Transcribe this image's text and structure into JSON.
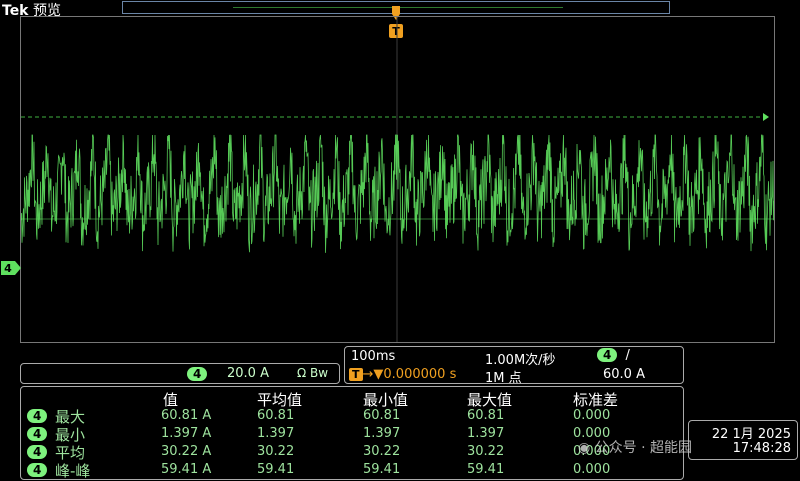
{
  "brand": {
    "logo": "Tek",
    "mode": "预览"
  },
  "colors": {
    "trace": "#5fe05f",
    "trigger": "#f0a020",
    "grid": "#6a85a6"
  },
  "trigger_marker": {
    "label": "T"
  },
  "channel": {
    "number": "4",
    "scale": "20.0 A",
    "bandwidth_icon": "Ω Bw"
  },
  "timebase": {
    "scale": "100ms",
    "rate": "1.00M次/秒",
    "trigger_pos": "0.000000 s",
    "record": "1M 点",
    "trigger_channel": "4",
    "trigger_slope": "/",
    "trigger_level": "60.0 A"
  },
  "measurements": {
    "headers": [
      "值",
      "平均值",
      "最小值",
      "最大值",
      "标准差"
    ],
    "rows": [
      {
        "ch": "4",
        "name": "最大",
        "value": "60.81 A",
        "mean": "60.81",
        "min": "60.81",
        "max": "60.81",
        "std": "0.000"
      },
      {
        "ch": "4",
        "name": "最小",
        "value": "1.397 A",
        "mean": "1.397",
        "min": "1.397",
        "max": "1.397",
        "std": "0.000"
      },
      {
        "ch": "4",
        "name": "平均",
        "value": "30.22 A",
        "mean": "30.22",
        "min": "30.22",
        "max": "30.22",
        "std": "0.000"
      },
      {
        "ch": "4",
        "name": "峰-峰",
        "value": "59.41 A",
        "mean": "59.41",
        "min": "59.41",
        "max": "59.41",
        "std": "0.000"
      }
    ]
  },
  "datetime": {
    "date": "22 1月 2025",
    "time": "17:48:28"
  },
  "watermark": "公众号 · 超能园"
}
